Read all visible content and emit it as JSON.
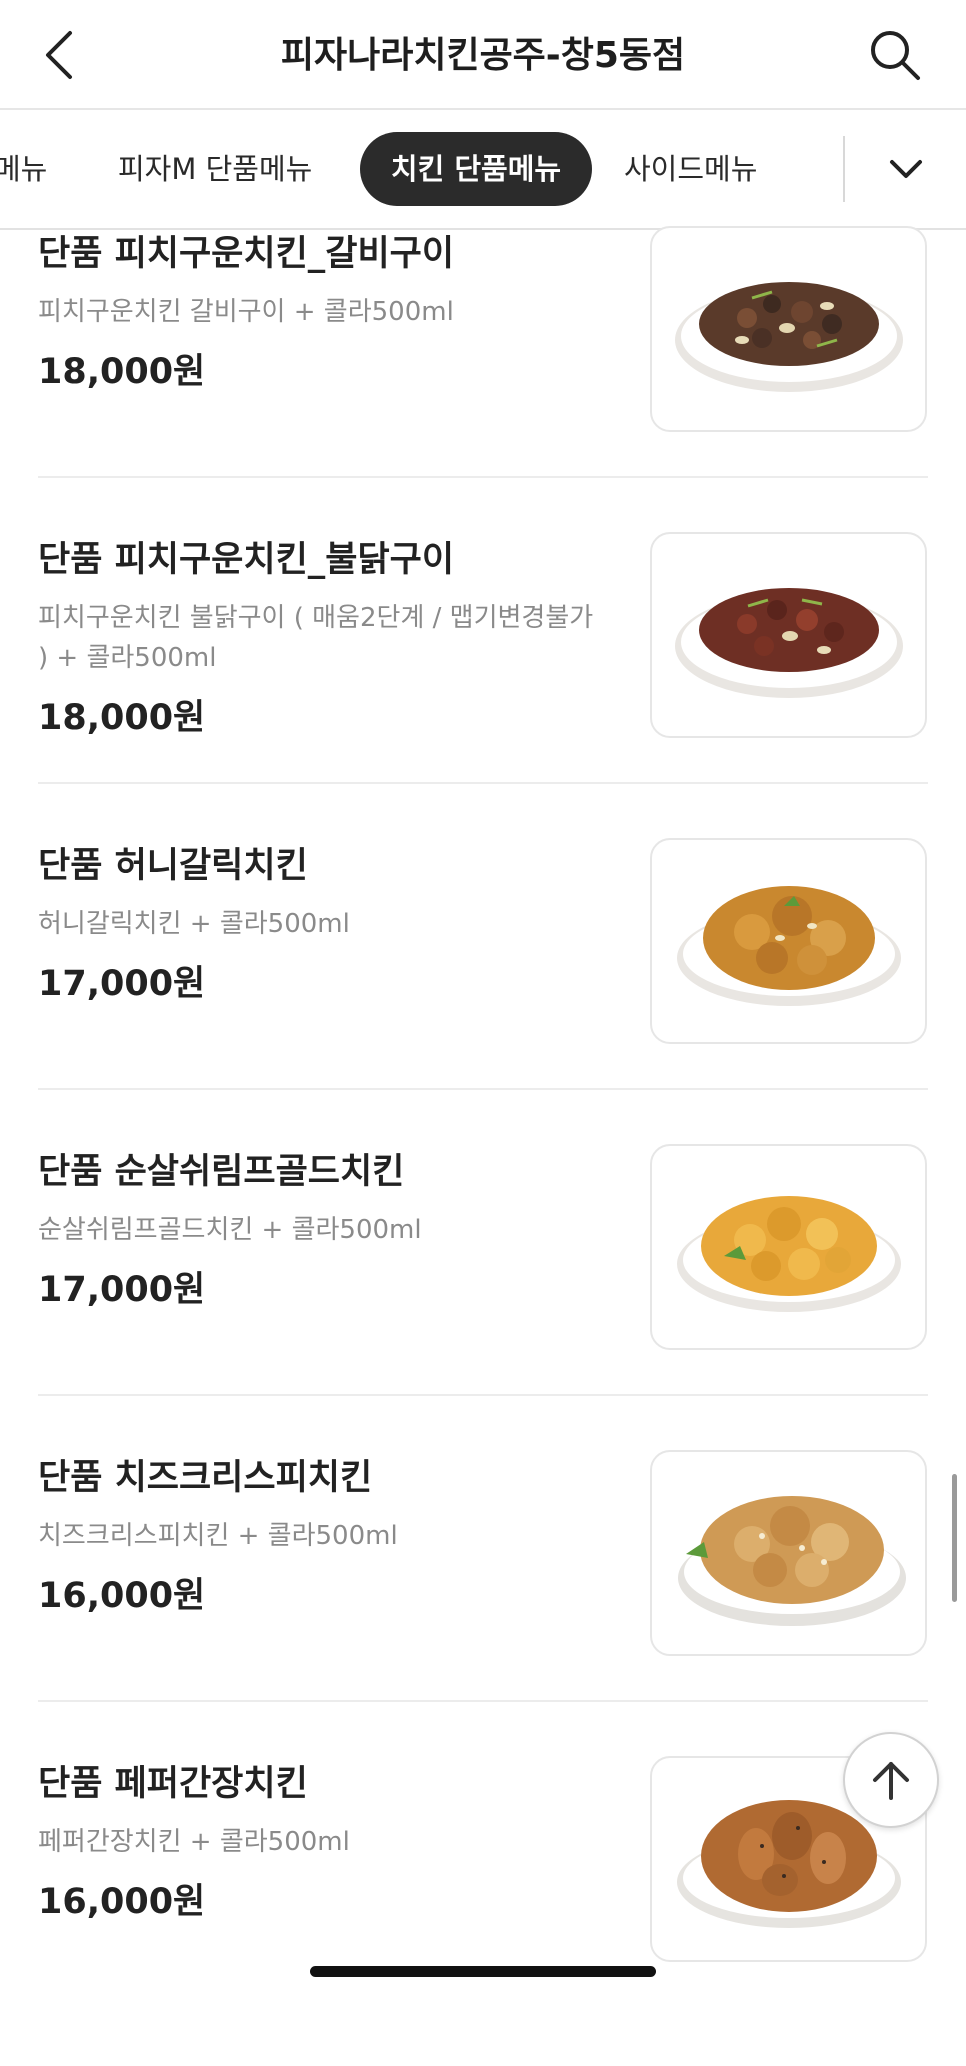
{
  "header": {
    "title": "피자나라치킨공주-창5동점",
    "back_icon": "back-chevron-icon",
    "search_icon": "search-icon"
  },
  "tabs": {
    "items": [
      {
        "label": "메뉴"
      },
      {
        "label": "피자M 단품메뉴"
      },
      {
        "label": "치킨 단품메뉴",
        "active": true
      },
      {
        "label": "사이드메뉴"
      }
    ],
    "expand_icon": "chevron-down-icon"
  },
  "menu": {
    "items": [
      {
        "name": "단품 피치구운치킨_갈비구이",
        "desc": "피치구운치킨 갈비구이 + 콜라500ml",
        "price": "18,000원",
        "image": "grilled-galbi-chicken-photo"
      },
      {
        "name": "단품 피치구운치킨_불닭구이",
        "desc": "피치구운치킨 불닭구이 ( 매움2단계  /  맵기변경불가 ) + 콜라500ml",
        "price": "18,000원",
        "image": "grilled-buldak-chicken-photo"
      },
      {
        "name": "단품 허니갈릭치킨",
        "desc": "허니갈릭치킨 + 콜라500ml",
        "price": "17,000원",
        "image": "honey-garlic-chicken-photo"
      },
      {
        "name": "단품 순살쉬림프골드치킨",
        "desc": "순살쉬림프골드치킨 + 콜라500ml",
        "price": "17,000원",
        "image": "boneless-shrimp-gold-chicken-photo"
      },
      {
        "name": "단품 치즈크리스피치킨",
        "desc": "치즈크리스피치킨 + 콜라500ml",
        "price": "16,000원",
        "image": "cheese-crispy-chicken-photo"
      },
      {
        "name": "단품 페퍼간장치킨",
        "desc": "페퍼간장치킨 + 콜라500ml",
        "price": "16,000원",
        "image": "pepper-soy-chicken-photo"
      }
    ]
  },
  "scroll_top_icon": "arrow-up-icon",
  "colors": {
    "active_tab_bg": "#2b2b2b",
    "active_tab_text": "#ffffff",
    "desc_text": "#8a8a8a",
    "divider": "#ececec"
  }
}
